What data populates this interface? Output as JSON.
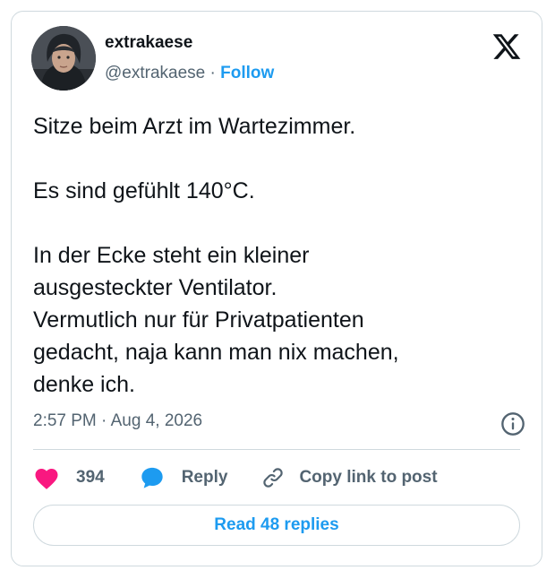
{
  "author": {
    "display_name": "extrakaese",
    "handle": "@extrakaese",
    "separator": "·",
    "follow_label": "Follow"
  },
  "tweet": {
    "paragraphs": [
      [
        "Sitze beim Arzt im Wartezimmer."
      ],
      [
        "Es sind gefühlt 140°C."
      ],
      [
        "In der Ecke steht ein kleiner",
        "ausgesteckter Ventilator.",
        "Vermutlich nur für Privatpatienten",
        "gedacht, naja kann man nix machen,",
        "denke ich."
      ]
    ],
    "time": "2:57 PM",
    "meta_separator": "·",
    "date": "Aug 4, 2026"
  },
  "actions": {
    "like_count": "394",
    "reply_label": "Reply",
    "copy_link_label": "Copy link to post"
  },
  "read_replies_label": "Read 48 replies",
  "icons": {
    "logo": "x-logo-icon",
    "info": "info-icon",
    "like": "heart-icon",
    "reply": "speech-bubble-icon",
    "copy": "link-icon"
  },
  "colors": {
    "accent": "#1d9bf0",
    "heart": "#f91880",
    "text": "#0f1419",
    "muted": "#536471",
    "border": "#cfd9de"
  }
}
